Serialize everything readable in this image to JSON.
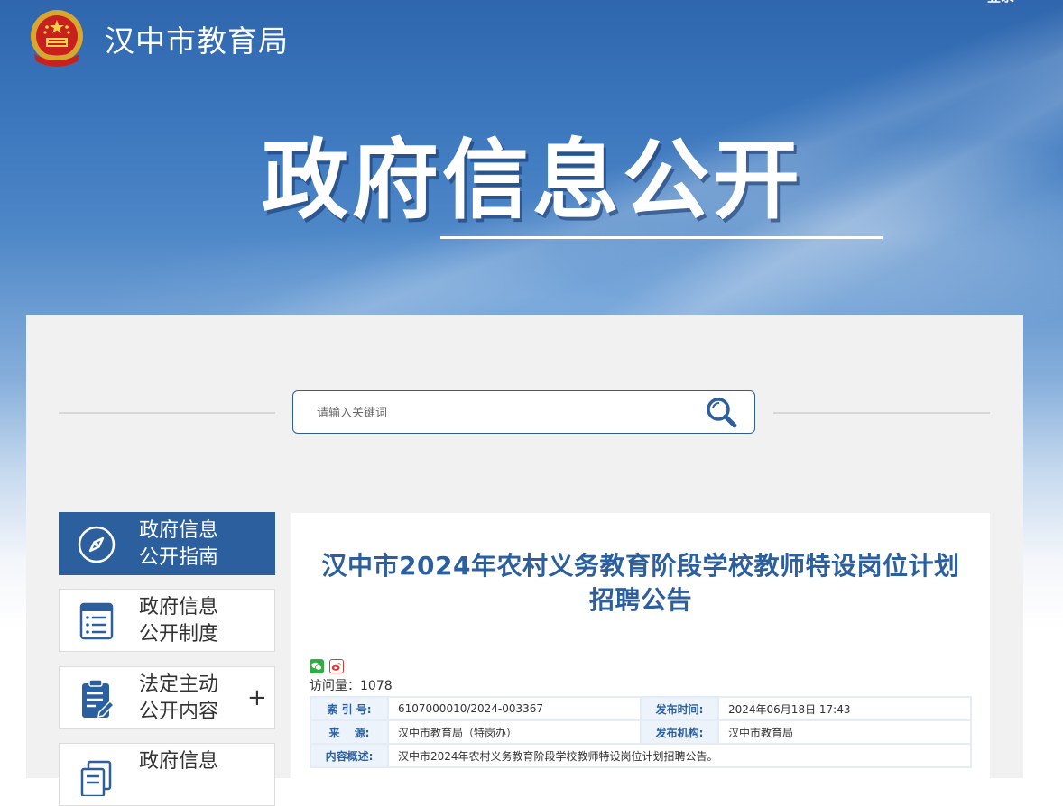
{
  "header": {
    "org_name": "汉中市教育局",
    "login": "登录",
    "emblem": "national-emblem",
    "hero_title": "政府信息公开"
  },
  "search": {
    "placeholder": "请输入关键词",
    "icon": "search-icon"
  },
  "sidebar": {
    "items": [
      {
        "line1": "政府信息",
        "line2": "公开指南",
        "icon": "compass-icon",
        "active": true
      },
      {
        "line1": "政府信息",
        "line2": "公开制度",
        "icon": "document-list-icon",
        "active": false
      },
      {
        "line1": "法定主动",
        "line2": "公开内容",
        "icon": "clipboard-edit-icon",
        "active": false,
        "expand": "+"
      },
      {
        "line1": "政府信息",
        "line2": "",
        "icon": "documents-icon",
        "active": false
      }
    ]
  },
  "article": {
    "title": "汉中市2024年农村义务教育阶段学校教师特设岗位计划招聘公告",
    "share": [
      "wechat-icon",
      "weibo-icon"
    ],
    "visits_label": "访问量：",
    "visits_value": "1078",
    "meta": {
      "index_label": "索  引  号:",
      "index_value": "6107000010/2024-003367",
      "pubtime_label": "发布时间:",
      "pubtime_value": "2024年06月18日 17:43",
      "source_label": "来　  源:",
      "source_value": "汉中市教育局（特岗办）",
      "publisher_label": "发布机构:",
      "publisher_value": "汉中市教育局",
      "summary_label": "内容概述:",
      "summary_value": "汉中市2024年农村义务教育阶段学校教师特设岗位计划招聘公告。"
    }
  },
  "colors": {
    "primary": "#2c5f9e",
    "banner_top": "#2f66ad",
    "panel_bg": "#f1f1f1",
    "label_bg": "#edf3fa"
  }
}
